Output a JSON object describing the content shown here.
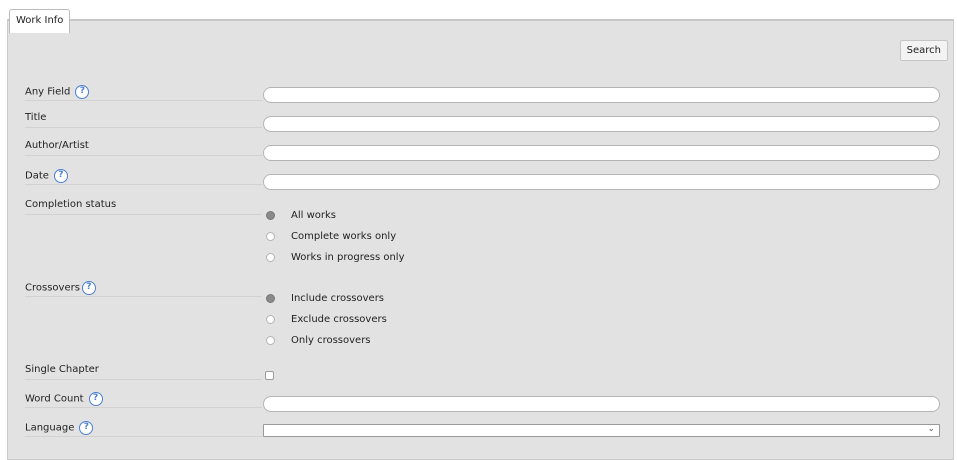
{
  "tab": {
    "label": "Work Info"
  },
  "search_button": {
    "label": "Search"
  },
  "fields": {
    "any_field": {
      "label": "Any Field",
      "value": "",
      "help": "?"
    },
    "title": {
      "label": "Title",
      "value": ""
    },
    "author": {
      "label": "Author/Artist",
      "value": ""
    },
    "date": {
      "label": "Date",
      "value": "",
      "help": "?"
    },
    "completion": {
      "label": "Completion status",
      "options": [
        "All works",
        "Complete works only",
        "Works in progress only"
      ],
      "selected": "All works"
    },
    "crossovers": {
      "label": "Crossovers",
      "help": "?",
      "options": [
        "Include crossovers",
        "Exclude crossovers",
        "Only crossovers"
      ],
      "selected": "Include crossovers"
    },
    "single_chapter": {
      "label": "Single Chapter",
      "checked": false
    },
    "word_count": {
      "label": "Word Count",
      "value": "",
      "help": "?"
    },
    "language": {
      "label": "Language",
      "selected": "",
      "help": "?"
    }
  },
  "colors": {
    "panel_bg": "#e2e2e2",
    "help_icon": "#4b7fd1"
  },
  "icons": {
    "help": "question-circle-icon",
    "select": "chevron-down-icon"
  }
}
